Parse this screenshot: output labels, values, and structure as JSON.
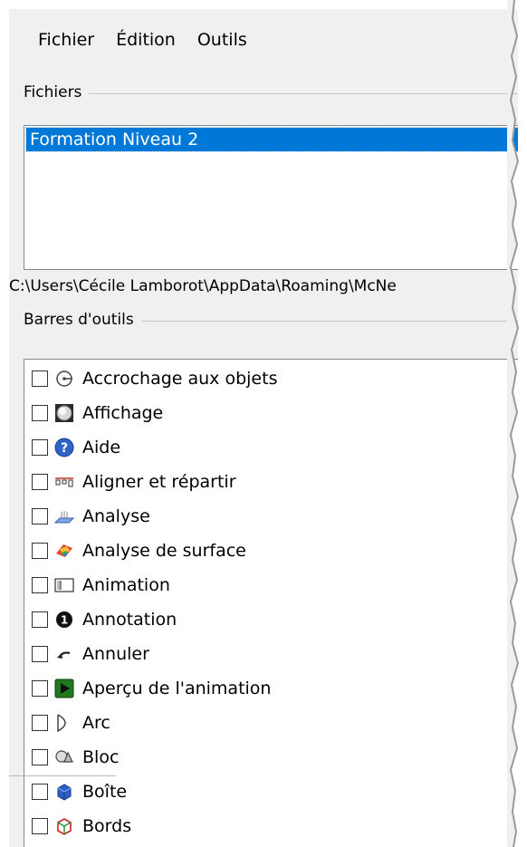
{
  "menu": {
    "items": [
      "Fichier",
      "Édition",
      "Outils"
    ]
  },
  "files_group": {
    "label": "Fichiers",
    "selected_file": "Formation Niveau 2",
    "path": "C:\\Users\\Cécile Lamborot\\AppData\\Roaming\\McNe"
  },
  "toolbars_group": {
    "label": "Barres d'outils",
    "items": [
      {
        "label": "Accrochage aux objets",
        "icon": "object-snap-icon",
        "checked": false
      },
      {
        "label": "Affichage",
        "icon": "display-sphere-icon",
        "checked": false
      },
      {
        "label": "Aide",
        "icon": "help-icon",
        "checked": false
      },
      {
        "label": "Aligner et répartir",
        "icon": "align-distribute-icon",
        "checked": false
      },
      {
        "label": "Analyse",
        "icon": "analysis-icon",
        "checked": false
      },
      {
        "label": "Analyse de surface",
        "icon": "surface-analysis-icon",
        "checked": false
      },
      {
        "label": "Animation",
        "icon": "animation-icon",
        "checked": false
      },
      {
        "label": "Annotation",
        "icon": "annotation-icon",
        "checked": false
      },
      {
        "label": "Annuler",
        "icon": "undo-icon",
        "checked": false
      },
      {
        "label": "Aperçu de l'animation",
        "icon": "animation-preview-icon",
        "checked": false
      },
      {
        "label": "Arc",
        "icon": "arc-icon",
        "checked": false
      },
      {
        "label": "Bloc",
        "icon": "block-icon",
        "checked": false
      },
      {
        "label": "Boîte",
        "icon": "box-icon",
        "checked": false
      },
      {
        "label": "Bords",
        "icon": "edges-icon",
        "checked": false
      }
    ]
  },
  "colors": {
    "selection": "#0078d7",
    "panel_bg": "#f0f0f0",
    "list_bg": "#ffffff"
  }
}
